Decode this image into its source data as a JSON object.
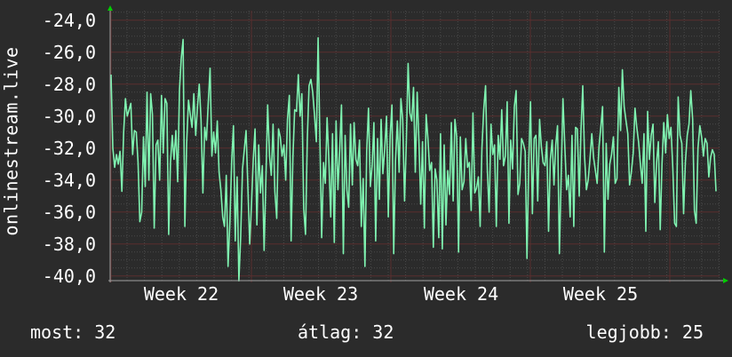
{
  "chart_data": {
    "type": "line",
    "ylabel": "onlinestream.live",
    "ylim": [
      -40.4,
      -23.4
    ],
    "y_tick_labels": [
      "-24,0",
      "-26,0",
      "-28,0",
      "-30,0",
      "-32,0",
      "-34,0",
      "-36,0",
      "-38,0",
      "-40,0"
    ],
    "x_tick_labels": [
      "Week 22",
      "Week 23",
      "Week 24",
      "Week 25"
    ],
    "grid": true,
    "colors": {
      "background": "#2b2b2b",
      "line": "#7ff2b0",
      "grid": "#4a4a4a",
      "axis_arrow": "#00cc00",
      "text": "#ffffff"
    },
    "series": [
      {
        "values": [
          -27.4,
          -32,
          -33.2,
          -32.4,
          -33,
          -32.2,
          -34.7,
          -31,
          -28.9,
          -30,
          -29.6,
          -29.2,
          -32.4,
          -30.9,
          -31,
          -32.9,
          -36.6,
          -36,
          -31.3,
          -34.4,
          -28.5,
          -34,
          -28.6,
          -29.9,
          -37,
          -31.8,
          -31.5,
          -34,
          -28.7,
          -32.3,
          -28.9,
          -29.2,
          -37.4,
          -32.9,
          -31.2,
          -32.7,
          -30.9,
          -34.1,
          -28.4,
          -26.4,
          -25.2,
          -36.9,
          -31.7,
          -29,
          -29.9,
          -30.7,
          -28.6,
          -31.2,
          -29.4,
          -28,
          -30.2,
          -34.8,
          -30.7,
          -31.5,
          -29.2,
          -27,
          -32.5,
          -31,
          -32.3,
          -30.3,
          -33.5,
          -34.6,
          -36.3,
          -36.9,
          -33.7,
          -39.4,
          -36.6,
          -32.8,
          -30.6,
          -37.8,
          -33.8,
          -40.3,
          -37.6,
          -33.3,
          -32.1,
          -30.9,
          -34.4,
          -38,
          -35.5,
          -32.7,
          -30.8,
          -36.8,
          -31.8,
          -34.8,
          -33.1,
          -38.4,
          -34,
          -29.3,
          -32.5,
          -33.7,
          -30.5,
          -34.7,
          -36.4,
          -30.8,
          -31.3,
          -32.5,
          -31.8,
          -34,
          -30.2,
          -28.7,
          -37.8,
          -32.6,
          -29.6,
          -29.7,
          -27.4,
          -30,
          -28.6,
          -35.8,
          -37.4,
          -31.5,
          -28.1,
          -27.7,
          -28.5,
          -29.9,
          -31.6,
          -25.1,
          -31.4,
          -37.6,
          -32.9,
          -34.2,
          -30.1,
          -32.8,
          -36.3,
          -31.1,
          -37.9,
          -30.3,
          -34.6,
          -32.1,
          -29.3,
          -38.6,
          -31.2,
          -34.6,
          -35.7,
          -30.5,
          -34.3,
          -30.4,
          -32.7,
          -33.1,
          -31.5,
          -36.9,
          -33.9,
          -39.4,
          -32.2,
          -29.5,
          -34.4,
          -33.1,
          -30.4,
          -37.8,
          -31.4,
          -35.2,
          -30.2,
          -33.6,
          -32,
          -30,
          -36.3,
          -31.2,
          -29.3,
          -38.6,
          -32.8,
          -30.3,
          -33.5,
          -28.9,
          -30.2,
          -35.3,
          -31.6,
          -26.7,
          -29.8,
          -30.3,
          -28.2,
          -33.5,
          -28.5,
          -31.6,
          -35.5,
          -31.6,
          -37,
          -29.9,
          -31.4,
          -33.4,
          -32.9,
          -38.2,
          -33.3,
          -34,
          -37.6,
          -31.1,
          -38.3,
          -31.8,
          -36.8,
          -33.4,
          -34.9,
          -30.4,
          -35.3,
          -30.2,
          -31.3,
          -38.5,
          -31.3,
          -34.6,
          -34.1,
          -31.4,
          -33.2,
          -32.9,
          -35.9,
          -29.8,
          -34.8,
          -34.5,
          -33.8,
          -36.9,
          -32,
          -29.6,
          -28.1,
          -33.4,
          -36,
          -30.5,
          -32.4,
          -31.8,
          -36.9,
          -31.2,
          -32.7,
          -29.6,
          -33.1,
          -32.5,
          -29.1,
          -36.7,
          -31.5,
          -33.3,
          -29.4,
          -28.4,
          -34.9,
          -34.2,
          -31.4,
          -31.7,
          -32.2,
          -38.9,
          -32.9,
          -29.1,
          -36.1,
          -31.4,
          -31.2,
          -35.3,
          -30.2,
          -31.9,
          -32.9,
          -33.1,
          -31.6,
          -37.2,
          -32.7,
          -31.5,
          -34.3,
          -31.8,
          -30.6,
          -38.6,
          -33.8,
          -28.9,
          -31.9,
          -34.6,
          -33.7,
          -36.3,
          -31.2,
          -36.9,
          -30.7,
          -30.8,
          -35,
          -30.9,
          -28.1,
          -32.5,
          -34.6,
          -34,
          -32.7,
          -31.1,
          -32.6,
          -33.4,
          -34.2,
          -31.9,
          -30.7,
          -29.4,
          -38.5,
          -31.7,
          -35.2,
          -33,
          -32.4,
          -31.3,
          -34.2,
          -33.9,
          -28.2,
          -30.9,
          -27.1,
          -29.4,
          -30.3,
          -31.1,
          -34.3,
          -33.5,
          -32.3,
          -29.5,
          -30.7,
          -31.6,
          -33,
          -34.2,
          -31.1,
          -37.2,
          -29.7,
          -32.7,
          -31.2,
          -30.5,
          -35.4,
          -32.9,
          -31.6,
          -37.1,
          -33,
          -30.4,
          -32.3,
          -29.9,
          -31.4,
          -30.7,
          -33.3,
          -36.7,
          -36.9,
          -28.8,
          -31.2,
          -31.7,
          -36.1,
          -32.9,
          -31.2,
          -30.5,
          -28.4,
          -30.2,
          -35.9,
          -36.7,
          -32,
          -30.6,
          -31.3,
          -32.5,
          -31.4,
          -31.7,
          -33.8,
          -32.6,
          -32.1,
          -32.4,
          -34.7
        ]
      }
    ]
  },
  "stats": {
    "current_label": "most:",
    "current_value": "32",
    "average_label": "átlag:",
    "average_value": "32",
    "best_label": "legjobb:",
    "best_value": "25"
  }
}
